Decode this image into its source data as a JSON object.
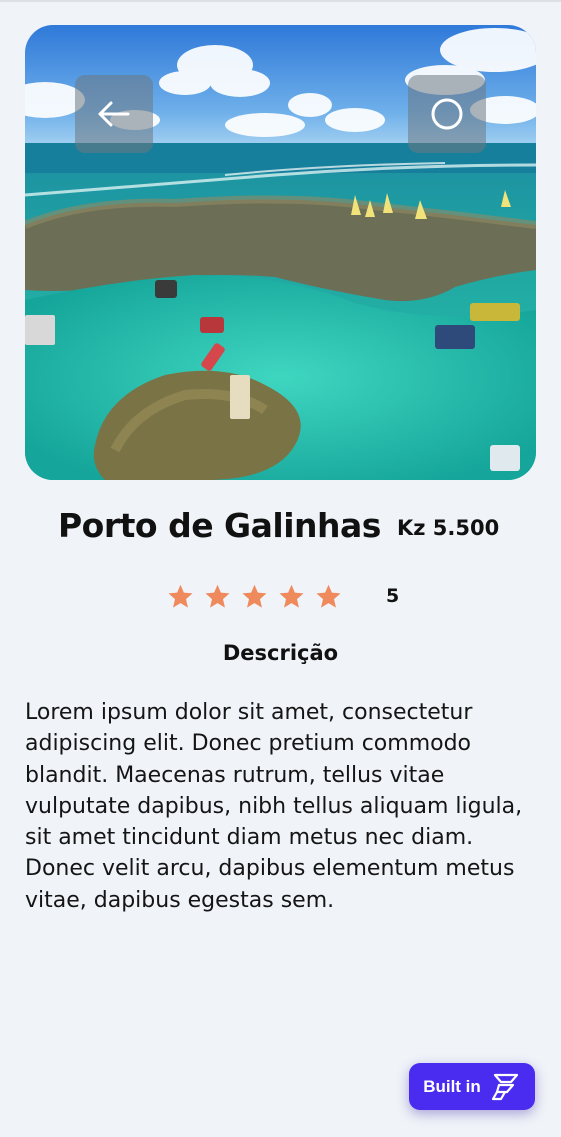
{
  "destination": {
    "name": "Porto de Galinhas",
    "price": "Kz 5.500",
    "rating": {
      "stars": 5,
      "max": 5,
      "value_label": "5"
    }
  },
  "description": {
    "heading": "Descrição",
    "text": "Lorem ipsum dolor sit amet, consectetur adipiscing elit. Donec pretium commodo blandit. Maecenas rutrum, tellus vitae vulputate dapibus, nibh tellus aliquam ligula, sit amet tincidunt diam metus nec diam. Donec velit arcu, dapibus elementum metus vitae, dapibus egestas sem."
  },
  "badge": {
    "label": "Built in"
  },
  "icons": {
    "back": "arrow-left-icon",
    "action": "circle-icon",
    "star": "star-icon",
    "badge_logo": "flutterflow-logo-icon"
  },
  "colors": {
    "background": "#f0f3f8",
    "star": "#ee8a5b",
    "badge": "#4a2bf0",
    "text": "#111111"
  }
}
